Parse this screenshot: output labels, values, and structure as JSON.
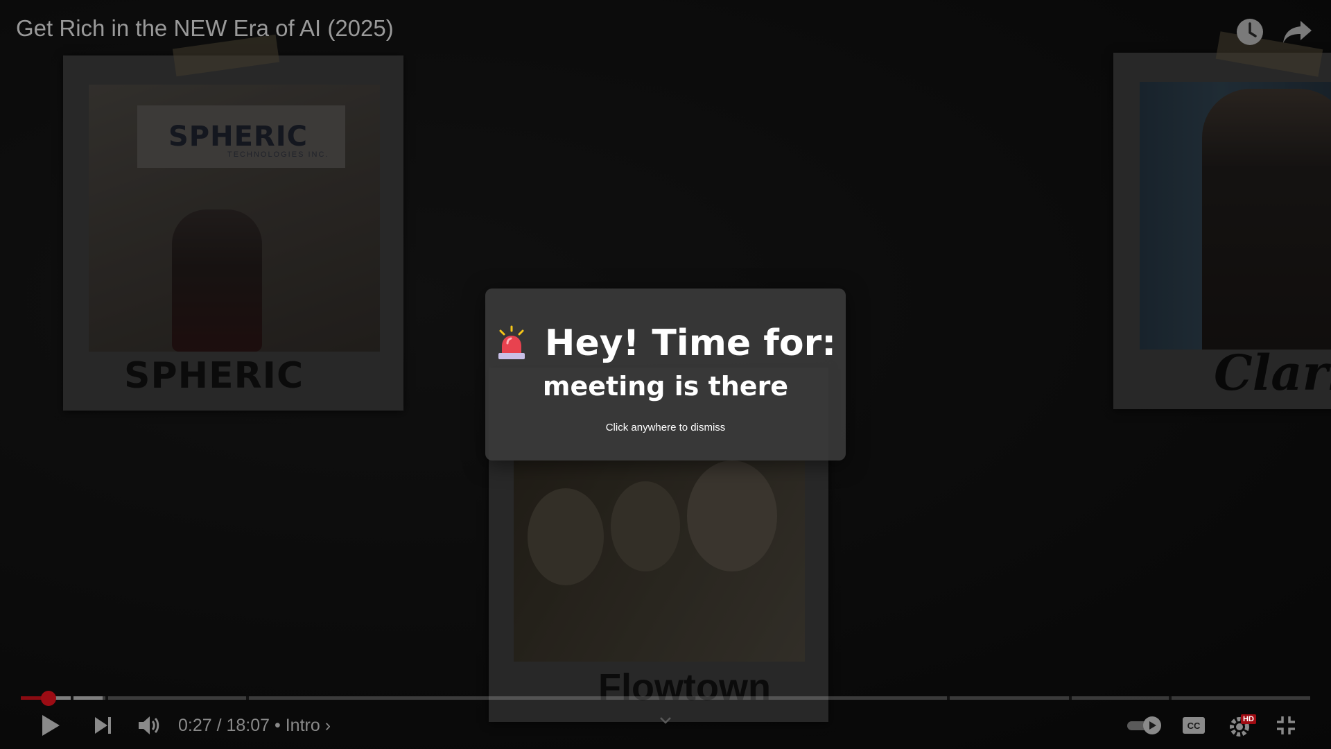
{
  "video": {
    "title": "Get Rich in the NEW Era of AI (2025)",
    "polaroids": [
      {
        "logo": "SPHERIC",
        "banner": "SPHERIC",
        "banner_sub": "TECHNOLOGIES INC."
      },
      {
        "logo": "Clarit"
      },
      {
        "logo": "Flowtown"
      }
    ]
  },
  "top_controls": {
    "watch_later_icon": "clock-icon",
    "share_icon": "share-arrow-icon"
  },
  "modal": {
    "icon": "siren-icon",
    "title": "Hey! Time for:",
    "message": "meeting is there",
    "hint": "Click anywhere to dismiss"
  },
  "player": {
    "time_current": "0:27",
    "time_total": "18:07",
    "time_display": "0:27 / 18:07",
    "separator": " • ",
    "chapter": "Intro",
    "chapter_chevron": "›",
    "progress_played_fraction": 0.0213,
    "progress_buffered_fraction": 0.0637,
    "hd_badge": "HD",
    "colors": {
      "progress": "#8a0b12",
      "hd_badge": "#cc0000"
    }
  }
}
